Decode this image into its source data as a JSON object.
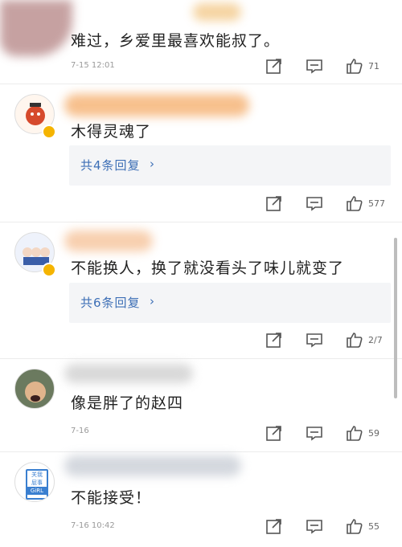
{
  "comments": [
    {
      "text": "难过，乡爱里最喜欢能叔了。",
      "time": "7-15 12:01",
      "likes": "71",
      "replies": ""
    },
    {
      "text": "木得灵魂了",
      "time": "",
      "likes": "577",
      "replies": "共4条回复"
    },
    {
      "text": "不能换人，换了就没看头了味儿就变了",
      "time": "",
      "likes": "2/7",
      "replies": "共6条回复"
    },
    {
      "text": "像是胖了的赵四",
      "time": "7-16",
      "likes": "59",
      "replies": ""
    },
    {
      "text": "不能接受！",
      "time": "7-16 10:42",
      "likes": "55",
      "replies": ""
    }
  ],
  "avatar4_text": {
    "l1": "关我",
    "l2": "屁事",
    "l3": "GiRL"
  },
  "colors": {
    "reply_link": "#3d6fb6",
    "verified_badge": "#f5b400"
  }
}
